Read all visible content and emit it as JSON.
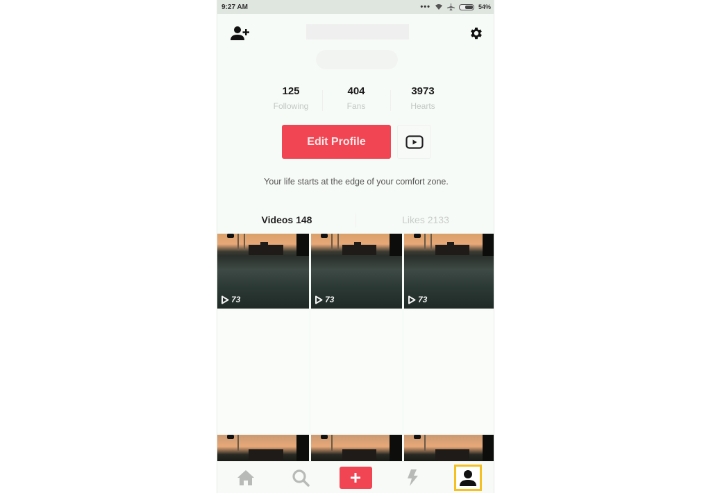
{
  "status_bar": {
    "time": "9:27 AM",
    "battery": "54%",
    "battery_level": 0.54,
    "icons": [
      "more-dots-icon",
      "wifi-icon",
      "airplane-mode-icon",
      "battery-icon"
    ]
  },
  "header": {
    "add_user_icon": "add-user-icon",
    "settings_icon": "gear-icon"
  },
  "stats": [
    {
      "value": "125",
      "label": "Following"
    },
    {
      "value": "404",
      "label": "Fans"
    },
    {
      "value": "3973",
      "label": "Hearts"
    }
  ],
  "actions": {
    "edit_profile_label": "Edit Profile",
    "video_icon": "video-play-icon"
  },
  "bio": "Your life starts at the edge of your comfort zone.",
  "tabs": [
    {
      "label": "Videos 148",
      "active": true
    },
    {
      "label": "Likes 2133",
      "active": false
    }
  ],
  "videos": [
    {
      "play_count": "73"
    },
    {
      "play_count": "73"
    },
    {
      "play_count": "73"
    }
  ],
  "bottom_nav": [
    {
      "name": "home",
      "icon": "home-icon"
    },
    {
      "name": "discover",
      "icon": "search-icon"
    },
    {
      "name": "create",
      "icon": "plus-icon"
    },
    {
      "name": "notifications",
      "icon": "lightning-icon"
    },
    {
      "name": "profile",
      "icon": "person-icon",
      "selected": true
    }
  ],
  "colors": {
    "accent": "#f24553",
    "highlight": "#f5c022",
    "background": "#f7fbf7"
  }
}
